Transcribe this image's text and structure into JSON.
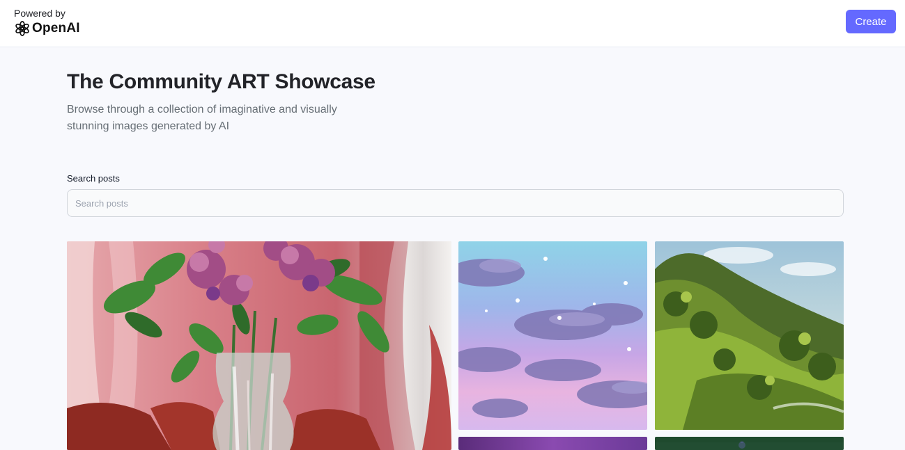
{
  "header": {
    "powered_by": "Powered by",
    "logo_text": "OpenAI",
    "logo_icon": "openai-logo-icon",
    "create_label": "Create",
    "accent_color": "#6469ff"
  },
  "hero": {
    "title": "The Community ART Showcase",
    "subtitle": "Browse through a collection of imaginative and visually stunning images generated by AI"
  },
  "search": {
    "label": "Search posts",
    "placeholder": "Search posts",
    "value": ""
  },
  "gallery": {
    "images": [
      {
        "subject": "flower-vase-painting"
      },
      {
        "subject": "purple-clouds-sky"
      },
      {
        "subject": "green-hills-landscape"
      },
      {
        "subject": "purple-gradient"
      },
      {
        "subject": "dark-green-scene"
      }
    ]
  }
}
